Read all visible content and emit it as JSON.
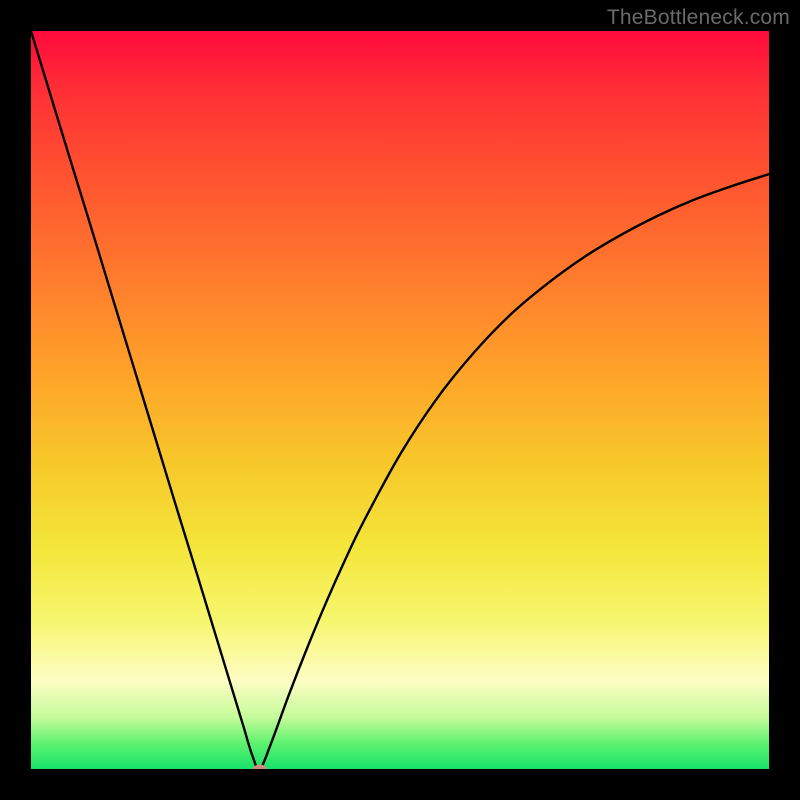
{
  "watermark": "TheBottleneck.com",
  "chart_data": {
    "type": "line",
    "title": "",
    "xlabel": "",
    "ylabel": "",
    "xlim": [
      0,
      100
    ],
    "ylim": [
      0,
      100
    ],
    "grid": false,
    "legend": false,
    "annotations": [],
    "series": [
      {
        "name": "curve",
        "color": "#000000",
        "x": [
          0,
          2.5,
          5,
          7.5,
          10,
          12.5,
          15,
          17.5,
          20,
          22.5,
          25,
          27.5,
          28.75,
          30,
          31,
          32.5,
          35,
          37.5,
          40,
          42.5,
          45,
          50,
          55,
          60,
          65,
          70,
          75,
          80,
          85,
          90,
          95,
          100
        ],
        "y": [
          100,
          91.8,
          83.6,
          75.5,
          67.3,
          59.1,
          50.9,
          42.7,
          34.5,
          26.4,
          18.2,
          10.0,
          5.9,
          1.8,
          0.0,
          3.4,
          10.2,
          16.6,
          22.6,
          28.2,
          33.4,
          42.6,
          50.2,
          56.4,
          61.6,
          65.8,
          69.4,
          72.4,
          75.0,
          77.2,
          79.0,
          80.6
        ]
      }
    ],
    "marker": {
      "x": 31,
      "y": 0,
      "color": "#d18a7f",
      "shape": "ellipse"
    },
    "background_gradient": {
      "axis": "y",
      "stops": [
        {
          "y": 100,
          "color": "#ff0a3c"
        },
        {
          "y": 75,
          "color": "#ff7a2d"
        },
        {
          "y": 50,
          "color": "#f7c62a"
        },
        {
          "y": 25,
          "color": "#f4e63a"
        },
        {
          "y": 5,
          "color": "#c6fb9a"
        },
        {
          "y": 0,
          "color": "#17e36b"
        }
      ]
    }
  }
}
